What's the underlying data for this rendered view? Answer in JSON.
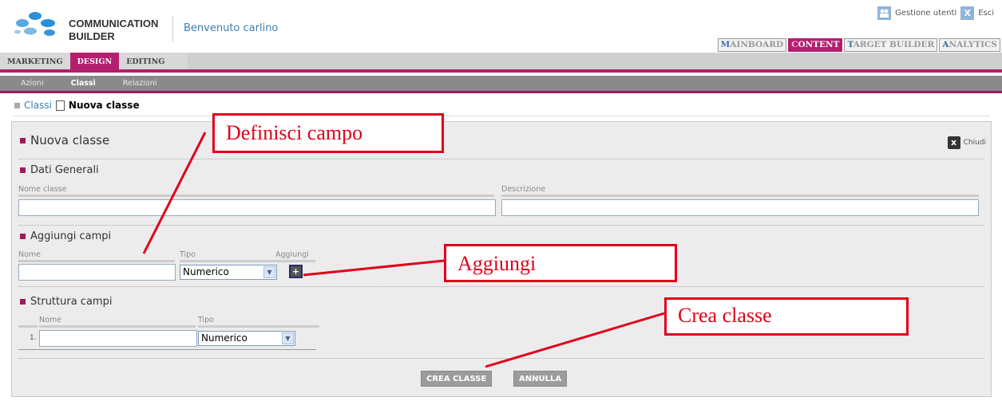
{
  "header": {
    "brand_line1": "COMMUNICATION",
    "brand_line2": "BUILDER",
    "welcome": "Benvenuto carlino",
    "user_mgmt": "Gestione utenti",
    "logout": "Esci",
    "logout_icon_char": "X",
    "right_tabs": [
      {
        "first": "M",
        "rest": "AINBOARD"
      },
      {
        "first": "C",
        "rest": "ONTENT"
      },
      {
        "first": "T",
        "rest": "ARGET BUILDER"
      },
      {
        "first": "A",
        "rest": "NALYTICS"
      }
    ],
    "active_tab_color": "#b31f6e"
  },
  "nav": {
    "level1": [
      "MARKETING",
      "DESIGN",
      "EDITING"
    ],
    "level2": [
      "Azioni",
      "Classi",
      "Relazioni"
    ]
  },
  "breadcrumb": {
    "parent": "Classi",
    "current": "Nuova classe"
  },
  "panel": {
    "title": "Nuova classe",
    "close_label": "Chiudi",
    "close_char": "x",
    "general": {
      "title": "Dati Generali",
      "name_label": "Nome classe",
      "desc_label": "Descrizione"
    },
    "add_fields": {
      "title": "Aggiungi campi",
      "name_label": "Nome",
      "type_label": "Tipo",
      "add_label": "Aggiungi",
      "type_value": "Numerico",
      "plus_char": "+"
    },
    "structure": {
      "title": "Struttura campi",
      "name_label": "Nome",
      "type_label": "Tipo",
      "rows": [
        {
          "num": "1.",
          "type_value": "Numerico"
        }
      ]
    },
    "buttons": {
      "create": "CREA CLASSE",
      "cancel": "ANNULLA"
    }
  },
  "annotations": {
    "define_field": "Definisci campo",
    "add": "Aggiungi",
    "create_class": "Crea classe",
    "color": "#e0001a"
  }
}
